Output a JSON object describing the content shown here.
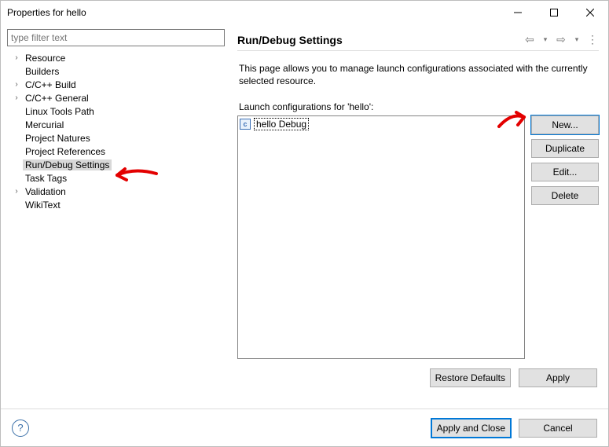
{
  "window": {
    "title": "Properties for hello"
  },
  "filter": {
    "placeholder": "type filter text"
  },
  "tree": [
    {
      "label": "Resource",
      "expandable": true
    },
    {
      "label": "Builders",
      "expandable": false
    },
    {
      "label": "C/C++ Build",
      "expandable": true
    },
    {
      "label": "C/C++ General",
      "expandable": true
    },
    {
      "label": "Linux Tools Path",
      "expandable": false
    },
    {
      "label": "Mercurial",
      "expandable": false
    },
    {
      "label": "Project Natures",
      "expandable": false
    },
    {
      "label": "Project References",
      "expandable": false
    },
    {
      "label": "Run/Debug Settings",
      "expandable": false,
      "selected": true
    },
    {
      "label": "Task Tags",
      "expandable": false
    },
    {
      "label": "Validation",
      "expandable": true
    },
    {
      "label": "WikiText",
      "expandable": false
    }
  ],
  "page": {
    "heading": "Run/Debug Settings",
    "intro": "This page allows you to manage launch configurations associated with the currently selected resource.",
    "list_label": "Launch configurations for 'hello':",
    "configs": [
      {
        "badge": "c",
        "name": "hello Debug"
      }
    ],
    "buttons": {
      "new": "New...",
      "duplicate": "Duplicate",
      "edit": "Edit...",
      "delete": "Delete",
      "restore": "Restore Defaults",
      "apply": "Apply"
    }
  },
  "footer": {
    "apply_close": "Apply and Close",
    "cancel": "Cancel"
  }
}
